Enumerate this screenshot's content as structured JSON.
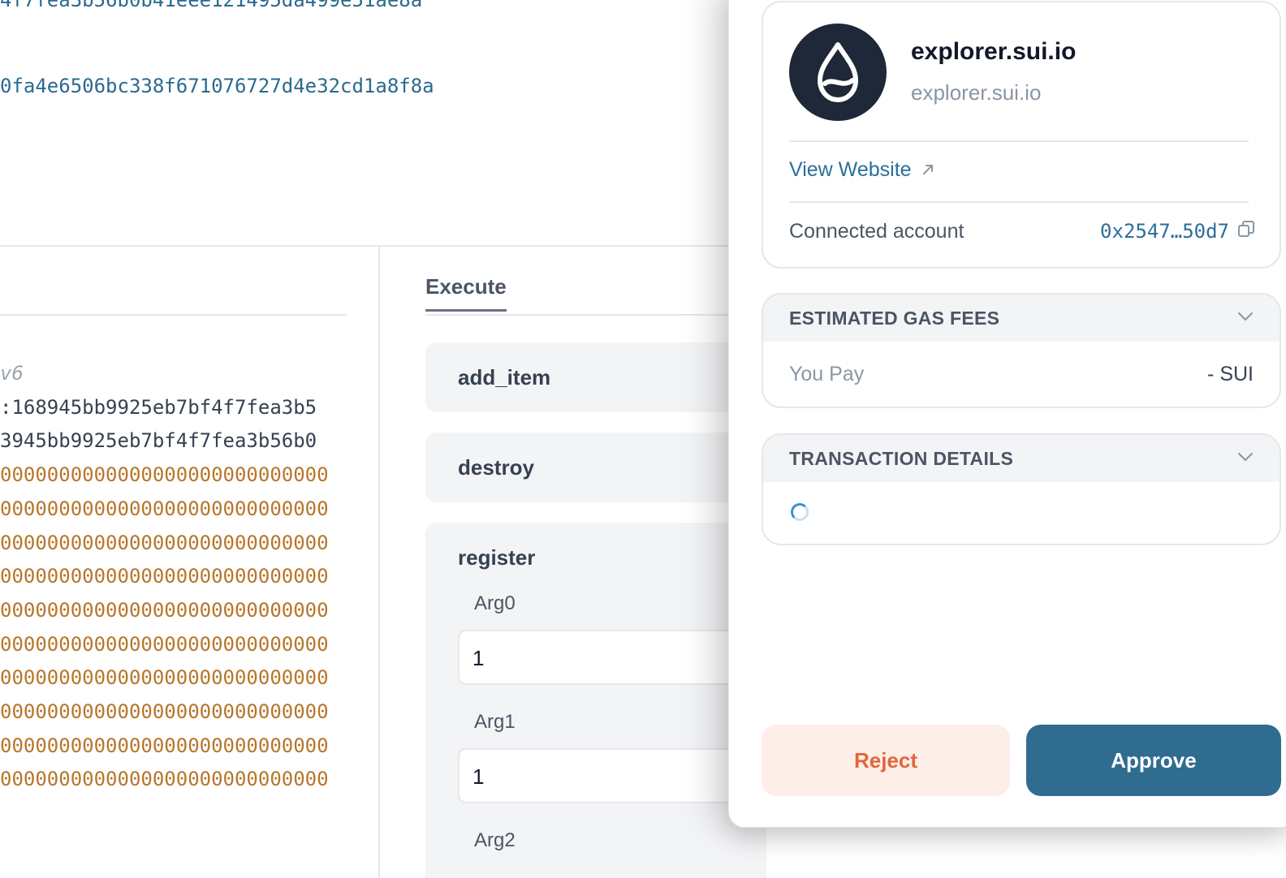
{
  "background": {
    "hash_top": "4f7fea3b56b0b41eee121495da499e51ae8a",
    "hash_second": "0fa4e6506bc338f671076727d4e32cd1a8f8a",
    "code_lines": [
      {
        "kind": "comment",
        "text": "v6"
      },
      {
        "kind": "dark",
        "text": ":168945bb9925eb7bf4f7fea3b5"
      },
      {
        "kind": "dark",
        "text": "3945bb9925eb7bf4f7fea3b56b0"
      },
      {
        "kind": "orange",
        "text": "0000000000000000000000000000"
      },
      {
        "kind": "orange",
        "text": "0000000000000000000000000000"
      },
      {
        "kind": "orange",
        "text": "0000000000000000000000000000"
      },
      {
        "kind": "orange",
        "text": "0000000000000000000000000000"
      },
      {
        "kind": "orange",
        "text": "0000000000000000000000000000"
      },
      {
        "kind": "orange",
        "text": "0000000000000000000000000000"
      },
      {
        "kind": "orange",
        "text": "0000000000000000000000000000"
      },
      {
        "kind": "orange",
        "text": "0000000000000000000000000000"
      },
      {
        "kind": "orange",
        "text": "0000000000000000000000000000"
      },
      {
        "kind": "orange",
        "text": "0000000000000000000000000000"
      }
    ],
    "execute_tab": "Execute",
    "functions": {
      "add_item": "add_item",
      "destroy": "destroy",
      "register": "register"
    },
    "args": [
      {
        "label": "Arg0",
        "value": "1"
      },
      {
        "label": "Arg1",
        "value": "1"
      },
      {
        "label": "Arg2",
        "value": ""
      }
    ]
  },
  "wallet": {
    "site_title": "explorer.sui.io",
    "site_domain": "explorer.sui.io",
    "view_website": "View Website",
    "connected_label": "Connected account",
    "connected_address": "0x2547…50d7",
    "gas_section_title": "ESTIMATED GAS FEES",
    "you_pay_label": "You Pay",
    "you_pay_value": "- SUI",
    "tx_section_title": "TRANSACTION DETAILS",
    "reject_label": "Reject",
    "approve_label": "Approve",
    "colors": {
      "accent": "#2f6c90",
      "reject_bg": "#fdeee7",
      "reject_text": "#e0663e",
      "logo_bg": "#1e2838"
    }
  }
}
